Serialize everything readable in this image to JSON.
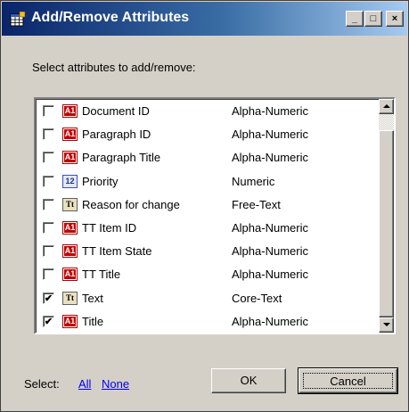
{
  "window": {
    "title": "Add/Remove Attributes",
    "title_icon": "table-edit-icon",
    "min_label": "_",
    "max_label": "□",
    "close_label": "×"
  },
  "prompt": "Select attributes to add/remove:",
  "attributes": [
    {
      "name": "Document ID",
      "type": "Alpha-Numeric",
      "icon": "alpha-numeric-icon",
      "icon_text": "A1",
      "checked": false
    },
    {
      "name": "Paragraph ID",
      "type": "Alpha-Numeric",
      "icon": "alpha-numeric-icon",
      "icon_text": "A1",
      "checked": false
    },
    {
      "name": "Paragraph Title",
      "type": "Alpha-Numeric",
      "icon": "alpha-numeric-icon",
      "icon_text": "A1",
      "checked": false
    },
    {
      "name": "Priority",
      "type": "Numeric",
      "icon": "numeric-icon",
      "icon_text": "12",
      "checked": false
    },
    {
      "name": "Reason for change",
      "type": "Free-Text",
      "icon": "free-text-icon",
      "icon_text": "Tt",
      "checked": false
    },
    {
      "name": "TT Item ID",
      "type": "Alpha-Numeric",
      "icon": "alpha-numeric-icon",
      "icon_text": "A1",
      "checked": false
    },
    {
      "name": "TT Item State",
      "type": "Alpha-Numeric",
      "icon": "alpha-numeric-icon",
      "icon_text": "A1",
      "checked": false
    },
    {
      "name": "TT Title",
      "type": "Alpha-Numeric",
      "icon": "alpha-numeric-icon",
      "icon_text": "A1",
      "checked": false
    },
    {
      "name": "Text",
      "type": "Core-Text",
      "icon": "free-text-icon",
      "icon_text": "Tt",
      "checked": true
    },
    {
      "name": "Title",
      "type": "Alpha-Numeric",
      "icon": "alpha-numeric-icon",
      "icon_text": "A1",
      "checked": true
    }
  ],
  "footer": {
    "select_label": "Select:",
    "all_link": "All",
    "none_link": "None",
    "ok_label": "OK",
    "cancel_label": "Cancel"
  }
}
